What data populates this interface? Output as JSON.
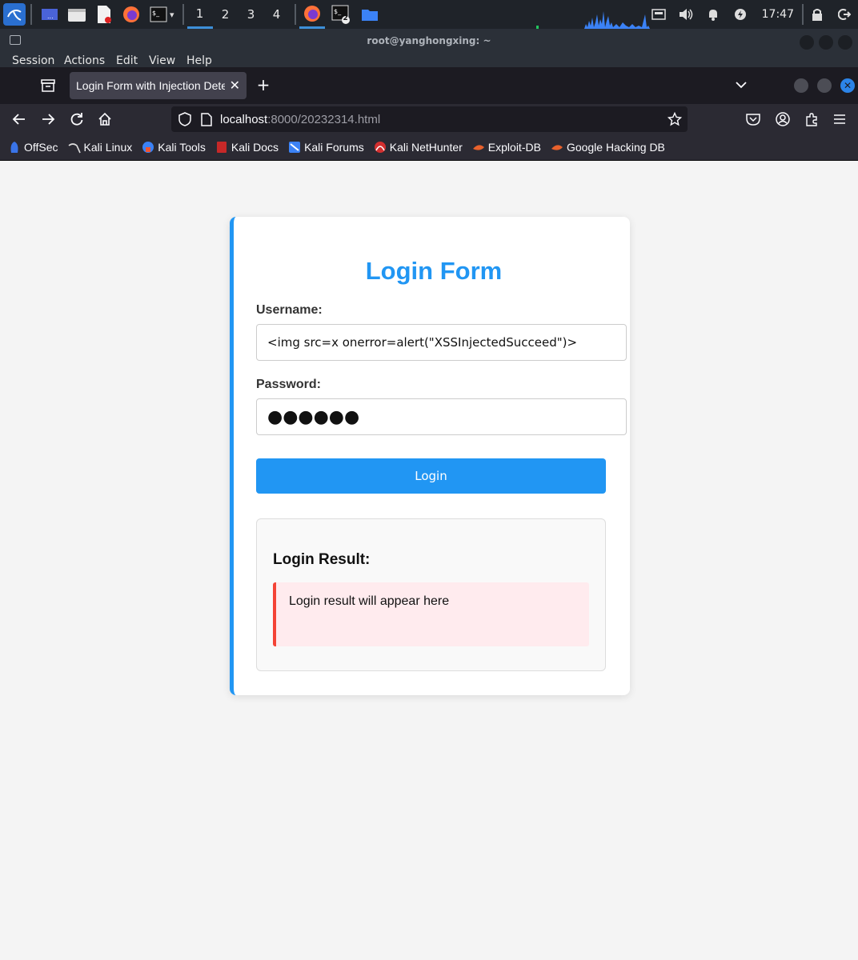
{
  "taskbar": {
    "workspaces": [
      "1",
      "2",
      "3",
      "4"
    ],
    "active_workspace": "1",
    "terminal_badge": "2",
    "clock": "17:47"
  },
  "terminal": {
    "title": "root@yanghongxing: ~",
    "menu": [
      "Session",
      "Actions",
      "Edit",
      "View",
      "Help"
    ]
  },
  "browser": {
    "tab_title": "Login Form with Injection Detection",
    "url_host": "localhost",
    "url_path": ":8000/20232314.html",
    "bookmarks": [
      "OffSec",
      "Kali Linux",
      "Kali Tools",
      "Kali Docs",
      "Kali Forums",
      "Kali NetHunter",
      "Exploit-DB",
      "Google Hacking DB"
    ]
  },
  "form": {
    "title": "Login Form",
    "username_label": "Username:",
    "username_value": "<img src=x onerror=alert(\"XSSInjectedSucceed\")>",
    "password_label": "Password:",
    "password_mask": "●●●●●●",
    "login_button": "Login",
    "result_heading": "Login Result:",
    "result_message": "Login result will appear here"
  },
  "colors": {
    "accent": "#2196f3",
    "error_border": "#f44336",
    "error_bg": "#ffebee"
  }
}
